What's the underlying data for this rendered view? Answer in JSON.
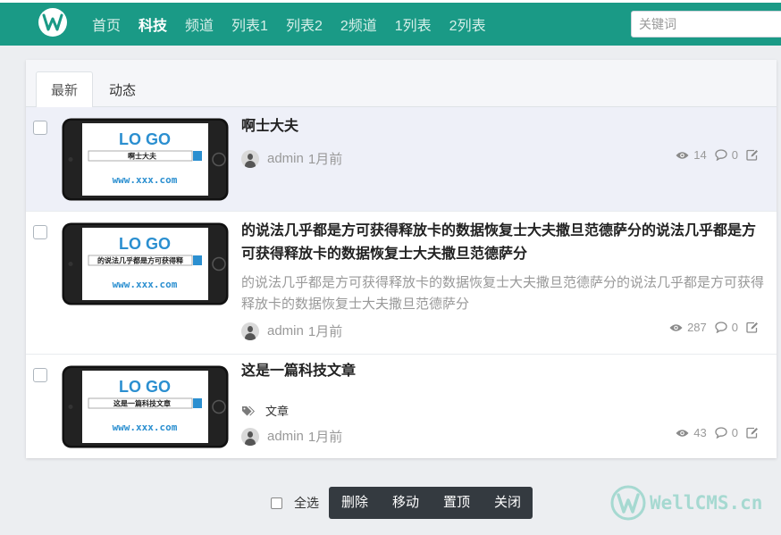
{
  "nav": {
    "items": [
      "首页",
      "科技",
      "频道",
      "列表1",
      "列表2",
      "2频道",
      "1列表",
      "2列表"
    ],
    "active_index": 1,
    "search_placeholder": "关键词"
  },
  "tabs": [
    "最新",
    "动态"
  ],
  "threads": [
    {
      "title": "啊士大夫",
      "summary": "",
      "tag": "",
      "thumb_text": "啊士大夫",
      "author": "admin",
      "time": "1月前",
      "views": "14",
      "comments": "0"
    },
    {
      "title": "的说法几乎都是方可获得释放卡的数据恢复士大夫撒旦范德萨分的说法几乎都是方可获得释放卡的数据恢复士大夫撒旦范德萨分",
      "summary": "的说法几乎都是方可获得释放卡的数据恢复士大夫撒旦范德萨分的说法几乎都是方可获得释放卡的数据恢复士大夫撒旦范德萨分",
      "tag": "",
      "thumb_text": "的说法几乎都是方可获得释",
      "author": "admin",
      "time": "1月前",
      "views": "287",
      "comments": "0"
    },
    {
      "title": "这是一篇科技文章",
      "summary": "",
      "tag": "文章",
      "thumb_text": "这是一篇科技文章",
      "author": "admin",
      "time": "1月前",
      "views": "43",
      "comments": "0"
    }
  ],
  "thumb": {
    "logo": "LO GO",
    "url": "www.xxx.com"
  },
  "footer": {
    "select_all": "全选",
    "actions": [
      "删除",
      "移动",
      "置顶",
      "关闭"
    ],
    "brand": "WellCMS.cn"
  },
  "colors": {
    "header": "#1a9a86",
    "highlight_row": "#eef0f8",
    "toolbar": "#343a40",
    "thumb_blue": "#2b8fd0"
  }
}
